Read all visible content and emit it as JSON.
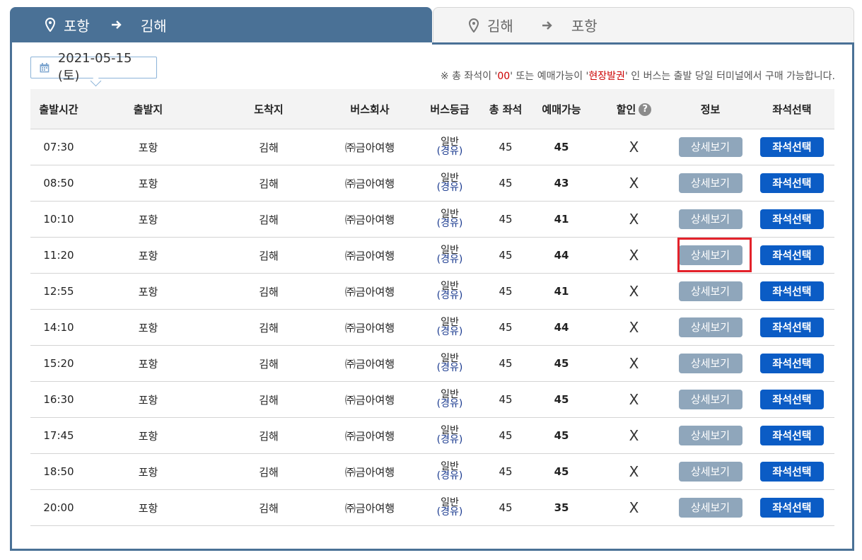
{
  "tabs": {
    "active": {
      "from": "포항",
      "to": "김해"
    },
    "inactive": {
      "from": "김해",
      "to": "포항"
    }
  },
  "date": "2021-05-15 (토)",
  "notice": {
    "part1": "※ 총 좌석이 '",
    "red1": "00",
    "part2": "' 또는 예매가능이 '",
    "red2": "현장발권",
    "part3": "' 인 버스는 출발 당일 터미널에서 구매 가능합니다."
  },
  "headers": {
    "departure_time": "출발시간",
    "origin": "출발지",
    "destination": "도착지",
    "bus_company": "버스회사",
    "bus_grade": "버스등급",
    "total_seats": "총 좌석",
    "available": "예매가능",
    "discount": "할인",
    "info": "정보",
    "seat_select": "좌석선택"
  },
  "help_icon": "?",
  "buttons": {
    "detail": "상세보기",
    "seat": "좌석선택"
  },
  "rows": [
    {
      "time": "07:30",
      "from": "포항",
      "to": "김해",
      "company": "㈜금아여행",
      "grade1": "일반",
      "grade2": "(경유)",
      "total": "45",
      "available": "45",
      "discount": "X"
    },
    {
      "time": "08:50",
      "from": "포항",
      "to": "김해",
      "company": "㈜금아여행",
      "grade1": "일반",
      "grade2": "(경유)",
      "total": "45",
      "available": "43",
      "discount": "X"
    },
    {
      "time": "10:10",
      "from": "포항",
      "to": "김해",
      "company": "㈜금아여행",
      "grade1": "일반",
      "grade2": "(경유)",
      "total": "45",
      "available": "41",
      "discount": "X"
    },
    {
      "time": "11:20",
      "from": "포항",
      "to": "김해",
      "company": "㈜금아여행",
      "grade1": "일반",
      "grade2": "(경유)",
      "total": "45",
      "available": "44",
      "discount": "X"
    },
    {
      "time": "12:55",
      "from": "포항",
      "to": "김해",
      "company": "㈜금아여행",
      "grade1": "일반",
      "grade2": "(경유)",
      "total": "45",
      "available": "41",
      "discount": "X"
    },
    {
      "time": "14:10",
      "from": "포항",
      "to": "김해",
      "company": "㈜금아여행",
      "grade1": "일반",
      "grade2": "(경유)",
      "total": "45",
      "available": "44",
      "discount": "X"
    },
    {
      "time": "15:20",
      "from": "포항",
      "to": "김해",
      "company": "㈜금아여행",
      "grade1": "일반",
      "grade2": "(경유)",
      "total": "45",
      "available": "45",
      "discount": "X"
    },
    {
      "time": "16:30",
      "from": "포항",
      "to": "김해",
      "company": "㈜금아여행",
      "grade1": "일반",
      "grade2": "(경유)",
      "total": "45",
      "available": "45",
      "discount": "X"
    },
    {
      "time": "17:45",
      "from": "포항",
      "to": "김해",
      "company": "㈜금아여행",
      "grade1": "일반",
      "grade2": "(경유)",
      "total": "45",
      "available": "45",
      "discount": "X"
    },
    {
      "time": "18:50",
      "from": "포항",
      "to": "김해",
      "company": "㈜금아여행",
      "grade1": "일반",
      "grade2": "(경유)",
      "total": "45",
      "available": "45",
      "discount": "X"
    },
    {
      "time": "20:00",
      "from": "포항",
      "to": "김해",
      "company": "㈜금아여행",
      "grade1": "일반",
      "grade2": "(경유)",
      "total": "45",
      "available": "35",
      "discount": "X"
    }
  ],
  "highlighted_row": 3,
  "colors": {
    "tab_active": "#4a7196",
    "detail_button": "#8fa6bb",
    "seat_button": "#0b5cc5",
    "highlight": "#e3222b"
  }
}
